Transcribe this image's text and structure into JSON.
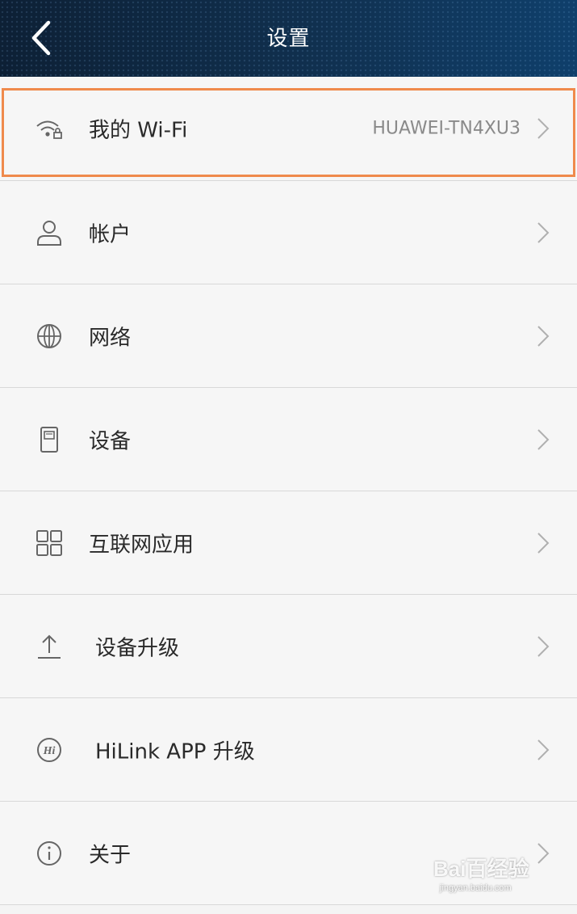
{
  "header": {
    "title": "设置",
    "back_icon": "chevron-left-icon"
  },
  "settings": {
    "items": [
      {
        "label": "我的 Wi-Fi",
        "value": "HUAWEI-TN4XU3",
        "icon": "wifi-lock-icon",
        "highlighted": true
      },
      {
        "label": "帐户",
        "icon": "user-icon"
      },
      {
        "label": "网络",
        "icon": "globe-icon"
      },
      {
        "label": "设备",
        "icon": "device-icon"
      },
      {
        "label": "互联网应用",
        "icon": "apps-grid-icon"
      },
      {
        "label": "设备升级",
        "icon": "upload-icon"
      },
      {
        "label": "HiLink APP 升级",
        "icon": "hilink-icon"
      },
      {
        "label": "关于",
        "icon": "info-icon"
      }
    ]
  },
  "watermark": {
    "main": "Bai百经验",
    "sub": "jingyan.baidu.com"
  },
  "colors": {
    "header_start": "#0d2035",
    "header_end": "#0f3f6b",
    "highlight": "#ef8a4c",
    "background": "#f4f4f4"
  }
}
